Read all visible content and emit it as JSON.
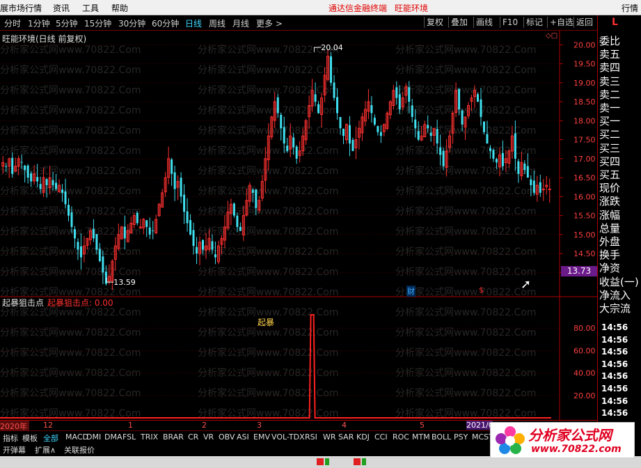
{
  "menu": {
    "left_cut": "展市场行情",
    "items": [
      "资讯",
      "工具",
      "帮助"
    ],
    "brand": "通达信金融终端",
    "brand2": "旺能环境",
    "right_cut": "行情"
  },
  "periods": {
    "items": [
      "分时",
      "1分钟",
      "5分钟",
      "15分钟",
      "30分钟",
      "60分钟",
      "日线",
      "周线",
      "月线",
      "更多 >"
    ],
    "active": "日线",
    "buttons": [
      "复权",
      "叠加",
      "画线",
      "F10",
      "标记",
      "+自选",
      "返回"
    ]
  },
  "main_chart": {
    "title": "旺能环境(日线 前复权)",
    "high_label": "20.04",
    "low_label": "13.59",
    "current_price_badge": "13.73",
    "marker_cai": "财",
    "marker_dollar": "$",
    "watermark": "分析家公式网www.70822.Com"
  },
  "indicator": {
    "title": "起暴狙击点",
    "value_label": "起暴狙击点: 0.00",
    "spike_label": "起暴"
  },
  "timeline": {
    "labels": [
      "2020年",
      "12",
      "1",
      "2",
      "3",
      "4",
      "5",
      "2021/0"
    ]
  },
  "right_panel": {
    "letter": "L",
    "labels": [
      "委比",
      "卖五",
      "卖四",
      "卖三",
      "卖二",
      "卖一",
      "买一",
      "买二",
      "买三",
      "买四",
      "买五",
      "现价",
      "涨跌",
      "涨幅",
      "总量",
      "外盘",
      "换手",
      "净资",
      "收益(一)",
      "净流入",
      "大宗流"
    ],
    "times": [
      "14:56",
      "14:56",
      "14:56",
      "14:56",
      "14:56",
      "14:56",
      "14:56",
      "14:56",
      "14:56"
    ]
  },
  "tabs": {
    "items": [
      "指标",
      "模板",
      "全部",
      "MACD",
      "DMI",
      "DMA",
      "FSL",
      "TRIX",
      "BRAR",
      "CR",
      "VR",
      "OBV",
      "ASI",
      "EMV",
      "VOL-TDX",
      "RSI",
      "WR",
      "SAR",
      "KDJ",
      "CCI",
      "ROC",
      "MTM",
      "BOLL",
      "PSY",
      "MCST"
    ],
    "active": "全部",
    "row2": [
      "开弹幕",
      "扩展∧",
      "关联报价"
    ]
  },
  "logo": {
    "title": "分析家公式网",
    "url": "www.70822.com"
  },
  "chart_data": [
    {
      "type": "candlestick",
      "title": "旺能环境(日线 前复权)",
      "ylim": [
        13.4,
        20.3
      ],
      "yticks": [
        14.0,
        14.5,
        15.0,
        15.5,
        16.0,
        16.5,
        17.0,
        17.5,
        18.0,
        18.5,
        19.0,
        19.5,
        20.0
      ],
      "ytick_labels": [
        "14.00",
        "14.50",
        "15.00",
        "15.50",
        "16.00",
        "16.50",
        "17.00",
        "17.50",
        "18.00",
        "18.50",
        "19.00",
        "19.50",
        "20.00"
      ],
      "up_color": "#ff3030",
      "down_color": "#3fe0f0",
      "close": [
        16.9,
        16.8,
        17.0,
        16.6,
        16.8,
        17.0,
        16.9,
        16.7,
        16.5,
        16.4,
        16.6,
        16.4,
        16.2,
        16.5,
        16.3,
        16.5,
        16.3,
        16.2,
        16.3,
        16.1,
        15.8,
        15.5,
        15.2,
        14.9,
        14.6,
        14.4,
        14.7,
        14.9,
        15.1,
        14.9,
        14.6,
        14.3,
        14.0,
        13.7,
        13.9,
        14.3,
        14.7,
        15.0,
        15.2,
        14.9,
        15.1,
        15.3,
        15.5,
        15.3,
        15.2,
        15.4,
        15.2,
        15.0,
        15.1,
        15.4,
        15.8,
        16.1,
        16.5,
        17.0,
        16.6,
        16.2,
        16.4,
        16.0,
        15.6,
        15.3,
        15.0,
        14.7,
        14.5,
        14.8,
        14.6,
        14.7,
        14.9,
        14.6,
        14.4,
        14.7,
        14.9,
        15.2,
        15.6,
        15.8,
        15.5,
        15.2,
        15.1,
        15.5,
        15.9,
        16.3,
        16.1,
        15.7,
        15.9,
        16.4,
        17.0,
        17.6,
        18.1,
        18.5,
        18.2,
        17.8,
        17.4,
        17.2,
        17.6,
        17.3,
        17.0,
        17.2,
        17.6,
        18.0,
        18.4,
        18.8,
        18.5,
        18.2,
        18.6,
        19.2,
        19.7,
        19.0,
        18.6,
        18.2,
        17.8,
        17.6,
        17.9,
        17.4,
        17.2,
        17.5,
        17.8,
        18.1,
        18.3,
        18.5,
        18.2,
        17.9,
        17.7,
        17.6,
        17.9,
        18.2,
        18.5,
        18.8,
        18.6,
        18.3,
        18.6,
        18.9,
        18.5,
        18.1,
        17.8,
        17.5,
        17.6,
        17.9,
        17.8,
        17.6,
        17.8,
        17.4,
        17.1,
        16.8,
        17.2,
        17.6,
        18.2,
        18.8,
        18.3,
        17.9,
        18.1,
        18.4,
        18.6,
        18.8,
        18.5,
        18.1,
        17.7,
        17.4,
        17.2,
        17.0,
        16.9,
        17.1,
        16.8,
        17.0,
        17.2,
        17.6,
        17.0,
        16.6,
        16.9,
        16.7,
        16.5,
        16.3,
        16.1,
        16.3,
        16.1,
        16.2,
        16.3,
        16.2
      ]
    },
    {
      "type": "line",
      "title": "起暴狙击点",
      "ylim": [
        0,
        100
      ],
      "yticks": [
        20,
        40,
        60,
        80
      ],
      "ytick_labels": [
        "20.00",
        "40.00",
        "60.00",
        "80.00"
      ],
      "spike_index": 99,
      "spike_value": 92,
      "color": "#ff2020"
    }
  ]
}
